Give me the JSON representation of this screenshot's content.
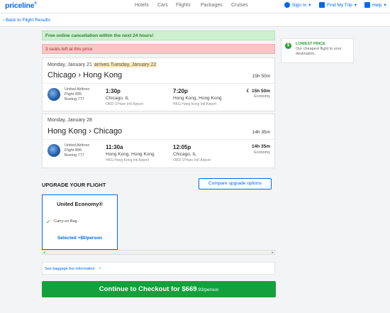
{
  "header": {
    "logo": "priceline",
    "logo_mark": "®",
    "nav": [
      "Hotels",
      "Cars",
      "Flights",
      "Packages",
      "Cruises"
    ],
    "sign_in": "Sign In",
    "find_trip": "Find My Trip",
    "help": "Help"
  },
  "back_link": "‹ Back to Flight Results",
  "banners": {
    "cancellation": "Free online cancellation within the next 24 hours!",
    "seats": "3 seats left at this price"
  },
  "outbound": {
    "date": "Monday, January 21",
    "arrives": "arrives Tuesday, January 22",
    "route": "Chicago › Hong Kong",
    "duration": "15h 50m",
    "airline": "United Airlines",
    "flight": "Flight 895",
    "aircraft": "Boeing 777",
    "dep_time": "1:30p",
    "dep_city": "Chicago, IL",
    "dep_airport": "ORD O'Hare Int'l Airport",
    "arr_time": "7:20p",
    "arr_city": "Hong Kong, Hong Kong",
    "arr_airport": "HKG Hong Kong Intl Airport",
    "seg_duration": "15h 50m",
    "cabin": "Economy"
  },
  "return": {
    "date": "Monday, January 28",
    "route": "Hong Kong › Chicago",
    "duration": "14h 35m",
    "airline": "United Airlines",
    "flight": "Flight 896",
    "aircraft": "Boeing 777",
    "dep_time": "11:30a",
    "dep_city": "Hong Kong, Hong Kong",
    "dep_airport": "HKG Hong Kong Intl Airport",
    "arr_time": "12:05p",
    "arr_city": "Chicago, IL",
    "arr_airport": "ORD O'Hare Int'l Airport",
    "seg_duration": "14h 35m",
    "cabin": "Economy"
  },
  "upgrade": {
    "title": "UPGRADE YOUR FLIGHT",
    "compare_button": "Compare upgrade options",
    "fare_name": "United Economy®",
    "feature": "Carry-on Bag",
    "selected": "Selected +$0/person"
  },
  "baggage_link": "See baggage fee information",
  "checkout": {
    "label": "Continue to Checkout for ",
    "price": "$669",
    "cents": ".93/person"
  },
  "lowest_price": {
    "title": "LOWEST PRICE",
    "desc": "Our cheapest flight to your destination."
  },
  "colors": {
    "brand": "#0068ef",
    "success": "#14a03c",
    "warning_bg": "#f8c6c6"
  }
}
